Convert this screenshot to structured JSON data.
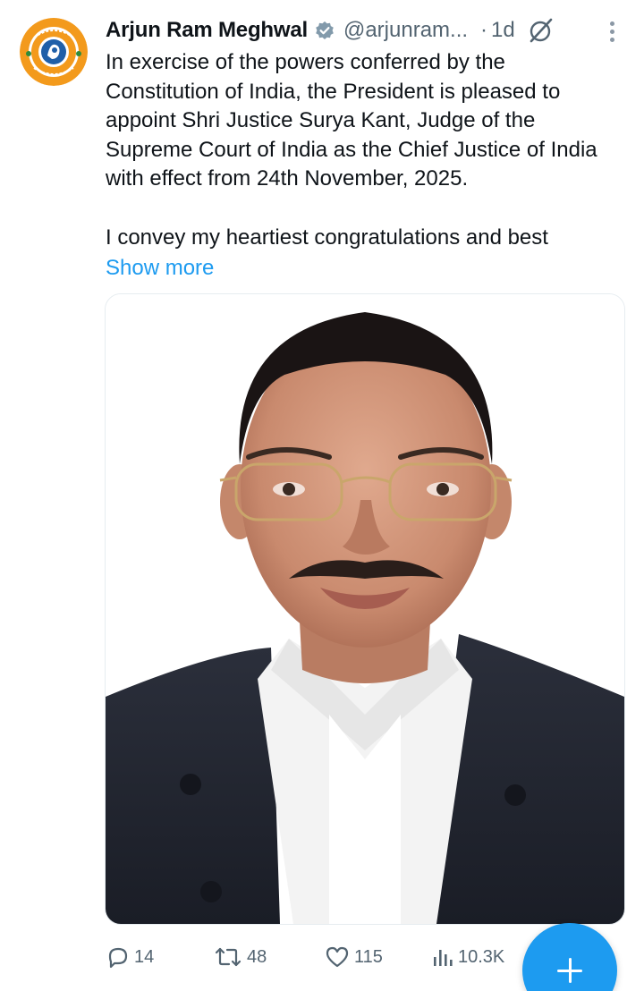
{
  "tweet": {
    "author_name": "Arjun Ram Meghwal",
    "handle": "@arjunram...",
    "separator": "·",
    "time": "1d",
    "paragraphs": [
      "In exercise of the powers conferred by the Constitution of India, the President is pleased to appoint Shri Justice Surya Kant, Judge of the Supreme Court of India as the Chief Justice of India with effect from 24th November, 2025.",
      "I convey my heartiest congratulations and best"
    ],
    "show_more": "Show more",
    "avatar_icon": "party-logo-avatar",
    "verified_icon": "verified-badge-icon",
    "grok_icon": "grok-icon",
    "more_icon": "more-vertical-icon",
    "media": {
      "description_icon": "portrait-photo"
    }
  },
  "actions": {
    "replies": "14",
    "reposts": "48",
    "likes": "115",
    "views": "10.3K",
    "reply_icon": "reply-icon",
    "repost_icon": "repost-icon",
    "like_icon": "heart-icon",
    "views_icon": "views-icon"
  },
  "fab": {
    "icon": "plus-icon"
  },
  "colors": {
    "accent": "#1d9bf0",
    "text_primary": "#0f1419",
    "text_secondary": "#536471",
    "verified": "#829aab",
    "avatar_orange": "#f39a1c",
    "avatar_blue": "#1f5fa8"
  }
}
